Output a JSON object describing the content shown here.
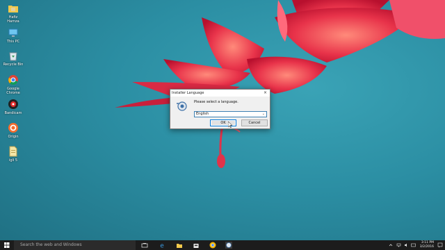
{
  "desktop": {
    "icons": [
      {
        "label": "Hafiz Hamza",
        "icon": "folder-icon"
      },
      {
        "label": "This PC",
        "icon": "computer-icon"
      },
      {
        "label": "Recycle Bin",
        "icon": "recycle-bin-icon"
      },
      {
        "label": "Google Chrome",
        "icon": "chrome-icon"
      },
      {
        "label": "Bandicam",
        "icon": "bandicam-icon"
      },
      {
        "label": "Origin",
        "icon": "origin-icon"
      },
      {
        "label": "igli 5",
        "icon": "file-icon"
      }
    ]
  },
  "dialog": {
    "title": "Installer Language",
    "close": "×",
    "prompt": "Please select a language.",
    "selected_language": "English",
    "ok_label": "OK",
    "cancel_label": "Cancel"
  },
  "taskbar": {
    "search_placeholder": "Search the web and Windows",
    "time": "3:11 PM",
    "date": "3/2/2016"
  },
  "colors": {
    "accent": "#0078d7",
    "taskbar": "#1c1c1c",
    "desktop": "#2b8ea3",
    "flower": "#e8334a"
  }
}
